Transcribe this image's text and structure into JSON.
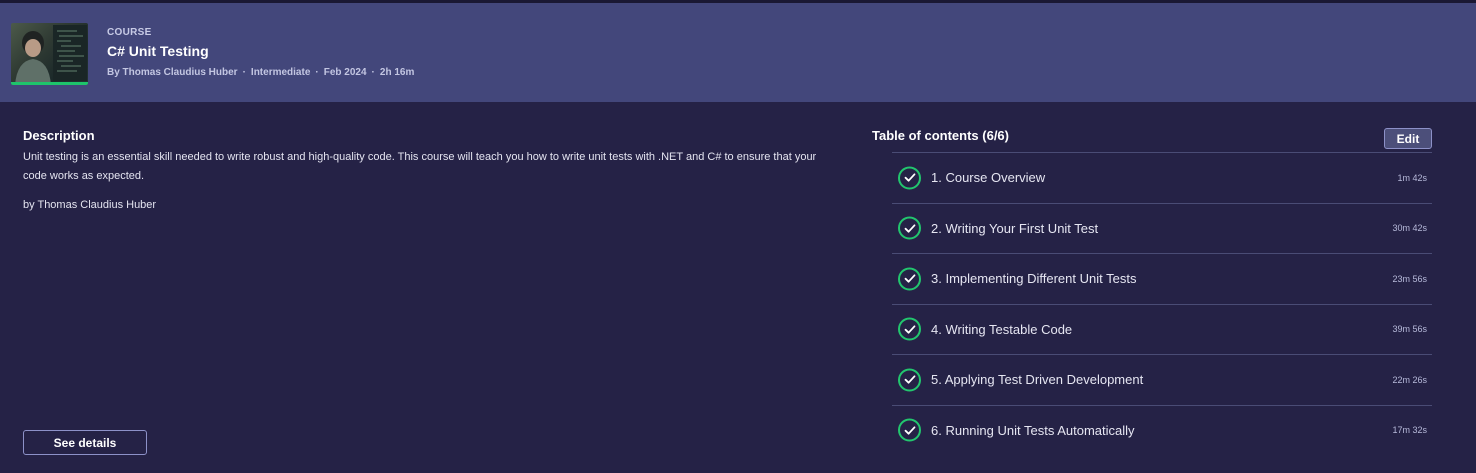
{
  "header": {
    "kicker": "COURSE",
    "title": "C# Unit Testing",
    "meta": {
      "author": "By Thomas Claudius Huber",
      "level": "Intermediate",
      "date": "Feb 2024",
      "duration": "2h 16m",
      "separator": "·"
    },
    "thumbnail_icon": "course-thumbnail-image"
  },
  "description": {
    "heading": "Description",
    "body": "Unit testing is an essential skill needed to write robust and high-quality code. This course will teach you how to write unit tests with .NET and C# to ensure that your code works as expected.",
    "byline": "by Thomas Claudius Huber",
    "see_details_label": "See details"
  },
  "toc": {
    "heading": "Table of contents (6/6)",
    "edit_label": "Edit",
    "items": [
      {
        "label": "1. Course Overview",
        "duration": "1m 42s",
        "icon": "check-circle-icon"
      },
      {
        "label": "2. Writing Your First Unit Test",
        "duration": "30m 42s",
        "icon": "check-circle-icon"
      },
      {
        "label": "3. Implementing Different Unit Tests",
        "duration": "23m 56s",
        "icon": "check-circle-icon"
      },
      {
        "label": "4. Writing Testable Code",
        "duration": "39m 56s",
        "icon": "check-circle-icon"
      },
      {
        "label": "5. Applying Test Driven Development",
        "duration": "22m 26s",
        "icon": "check-circle-icon"
      },
      {
        "label": "6. Running Unit Tests Automatically",
        "duration": "17m 32s",
        "icon": "check-circle-icon"
      }
    ]
  },
  "colors": {
    "background": "#252246",
    "header": "#43477b",
    "check": "#22c66e"
  }
}
